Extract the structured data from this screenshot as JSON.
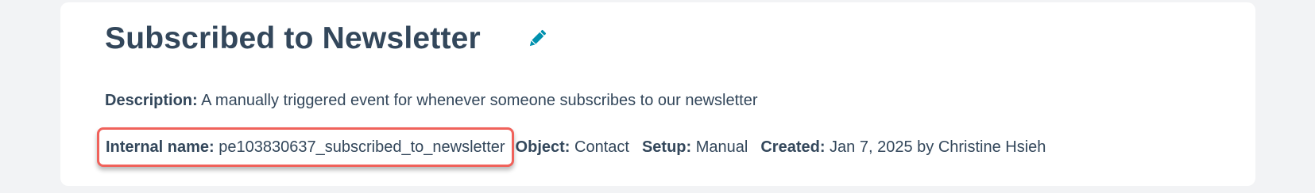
{
  "event": {
    "title": "Subscribed to Newsletter",
    "edit_icon": "pencil-icon",
    "description_label": "Description:",
    "description_value": "A manually triggered event for whenever someone subscribes to our newsletter",
    "internal_name_label": "Internal name:",
    "internal_name_value": "pe103830637_subscribed_to_newsletter",
    "object_label": "Object:",
    "object_value": "Contact",
    "setup_label": "Setup:",
    "setup_value": "Manual",
    "created_label": "Created:",
    "created_value": "Jan 7, 2025 by Christine Hsieh"
  },
  "colors": {
    "text": "#33475b",
    "accent_edit_icon": "#0091ae",
    "highlight_border": "#f0625b",
    "page_background": "#f2f3f5",
    "card_background": "#ffffff"
  }
}
